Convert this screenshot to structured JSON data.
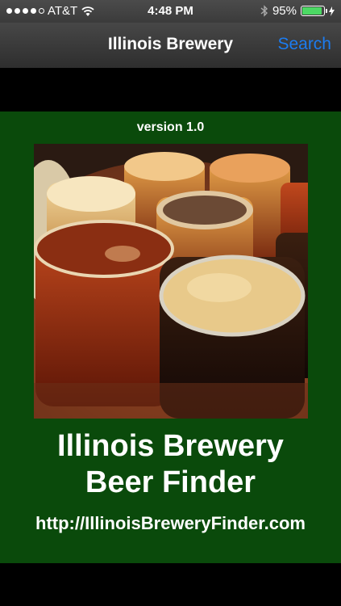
{
  "status_bar": {
    "carrier": "AT&T",
    "time": "4:48 PM",
    "battery_percent": "95%",
    "battery_level": 0.95,
    "signal_bars_filled": 4,
    "signal_bars_total": 5
  },
  "nav": {
    "title": "Illinois Brewery",
    "search_label": "Search"
  },
  "splash": {
    "version": "version 1.0",
    "title_line1": "Illinois Brewery",
    "title_line2": "Beer Finder",
    "url": "http://IllinoisBreweryFinder.com",
    "photo_icon": "beer-flight-photo"
  },
  "colors": {
    "panel_green": "#0a4a0b",
    "nav_link_blue": "#1c7cf0",
    "battery_green": "#4cd964"
  }
}
